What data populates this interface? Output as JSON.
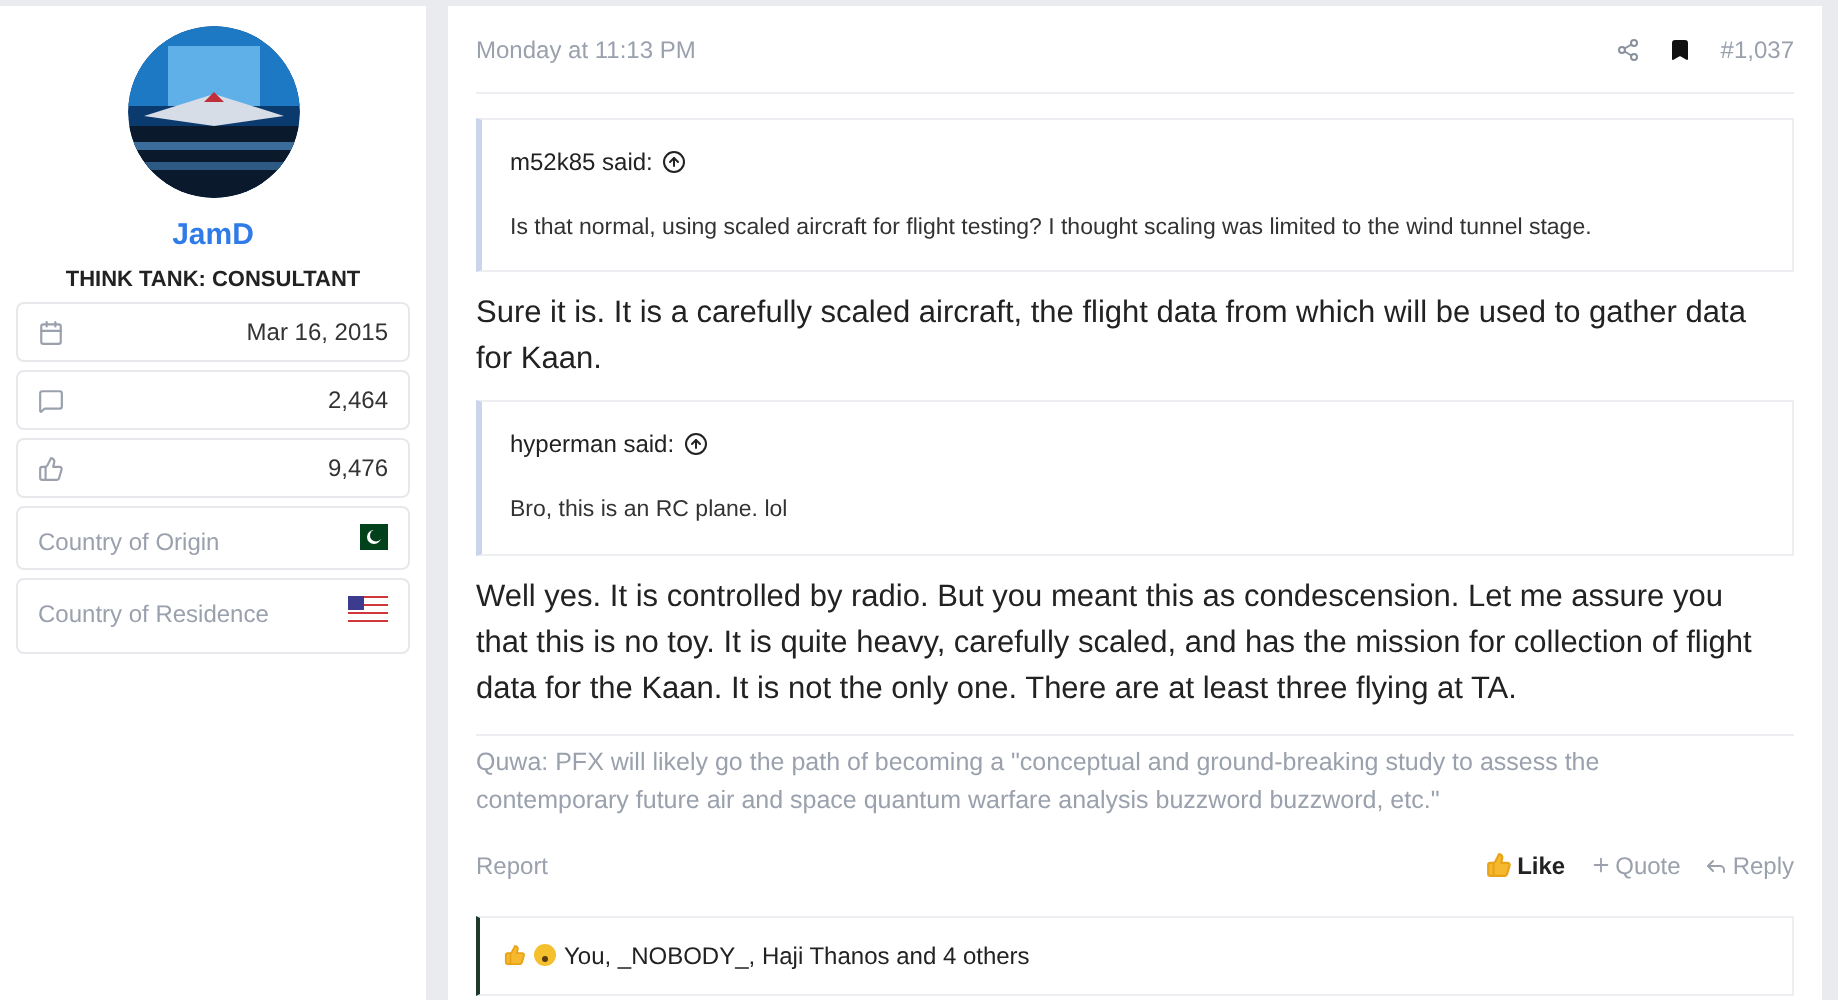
{
  "user": {
    "name": "JamD",
    "title": "THINK TANK: CONSULTANT",
    "stats": [
      {
        "kind": "joined",
        "value": "Mar 16, 2015"
      },
      {
        "kind": "messages",
        "value": "2,464"
      },
      {
        "kind": "reactions",
        "value": "9,476"
      }
    ],
    "fields": [
      {
        "label": "Country of Origin",
        "kind": "pakistan"
      },
      {
        "label": "Country of Residence",
        "kind": "usa"
      }
    ]
  },
  "post": {
    "time": "Monday at 11:13 PM",
    "bookmarked": true,
    "number": "#1,037",
    "blocks": [
      {
        "kind": "quote",
        "author": "m52k85 said:",
        "text": "Is that normal, using scaled aircraft for flight testing? I thought scaling was limited to the wind tunnel stage."
      },
      {
        "kind": "text",
        "text": "Sure it is. It is a carefully scaled aircraft, the flight data from which will be used to gather data for Kaan."
      },
      {
        "kind": "quote",
        "author": "hyperman said:",
        "text": "Bro, this is an RC plane. lol"
      },
      {
        "kind": "text",
        "text": "Well yes. It is controlled by radio. But you meant this as condescension. Let me assure you that this is no toy. It is quite heavy, carefully scaled, and has the mission for collection of flight data for the Kaan. It is not the only one. There are at least three flying at TA."
      }
    ],
    "signature": "Quwa: PFX will likely go the path of becoming a \"conceptual and ground-breaking study to assess the contemporary future air and space quantum warfare analysis buzzword buzzword, etc.\"",
    "actions": {
      "report": "Report",
      "like": "Like",
      "liked": true,
      "quote": "Quote",
      "reply": "Reply"
    },
    "reactions": "You, _NOBODY_, Haji Thanos and 4 others"
  }
}
